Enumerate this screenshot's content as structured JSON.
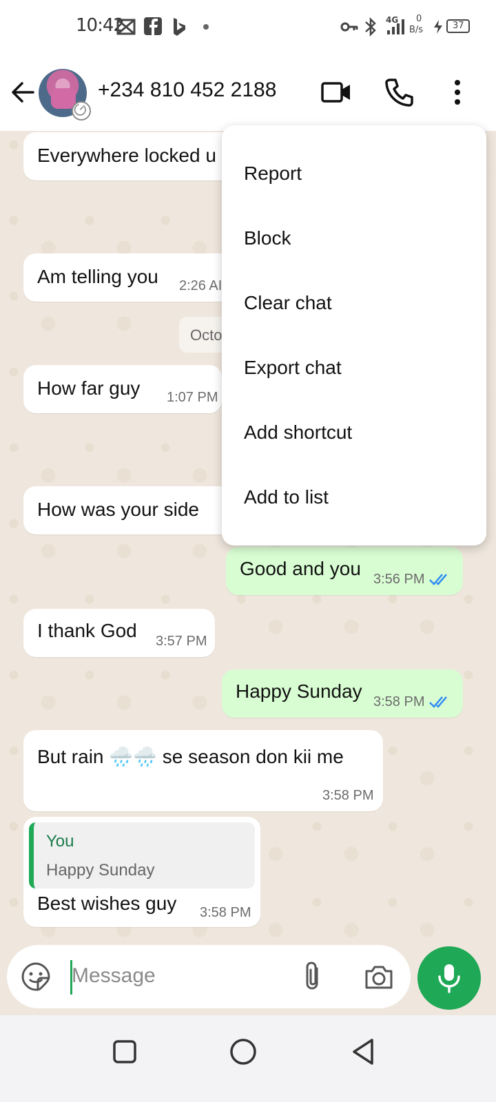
{
  "status_bar": {
    "time": "10:42",
    "network_type": "4G",
    "data_speed_value": "0",
    "data_speed_unit": "B/s",
    "battery": "37",
    "icons": [
      "capcut-icon",
      "facebook-icon",
      "bing-icon",
      "dot-icon",
      "key-icon",
      "bluetooth-icon",
      "signal-icon",
      "charging-icon",
      "battery-icon"
    ]
  },
  "header": {
    "contact": "+234 810 452 2188",
    "icons": [
      "back-arrow-icon",
      "video-call-icon",
      "phone-call-icon",
      "more-options-icon"
    ]
  },
  "chat": {
    "date_chip": "Octo",
    "messages": [
      {
        "direction": "in",
        "text": "Everywhere locked u",
        "time": ""
      },
      {
        "direction": "in",
        "text": "Am telling you",
        "time": "2:26 AI"
      },
      {
        "direction": "in",
        "text": "How far guy",
        "time": "1:07 PM"
      },
      {
        "direction": "in",
        "text": "How was your side",
        "time": ""
      },
      {
        "direction": "out",
        "text": "Good and you",
        "time": "3:56 PM",
        "read": true
      },
      {
        "direction": "in",
        "text": "I thank God",
        "time": "3:57 PM"
      },
      {
        "direction": "out",
        "text": "Happy Sunday",
        "time": "3:58 PM",
        "read": true
      },
      {
        "direction": "in",
        "text": "But rain 🌧️🌧️ se season don kii me",
        "time": "3:58 PM"
      },
      {
        "direction": "in",
        "text": "Best wishes guy",
        "time": "3:58 PM",
        "quote": {
          "author": "You",
          "text": "Happy Sunday"
        }
      }
    ]
  },
  "menu": {
    "items": [
      "Report",
      "Block",
      "Clear chat",
      "Export chat",
      "Add shortcut",
      "Add to list"
    ]
  },
  "composer": {
    "placeholder": "Message",
    "icons": [
      "sticker-icon",
      "attach-icon",
      "camera-icon",
      "mic-icon"
    ]
  },
  "nav": {
    "icons": [
      "recents-square-icon",
      "home-circle-icon",
      "back-triangle-icon"
    ]
  },
  "colors": {
    "accent_green": "#1fa855",
    "outgoing_bubble": "#d9fdd3",
    "read_ticks": "#2f8cf0",
    "wallpaper": "#efe7dd"
  }
}
